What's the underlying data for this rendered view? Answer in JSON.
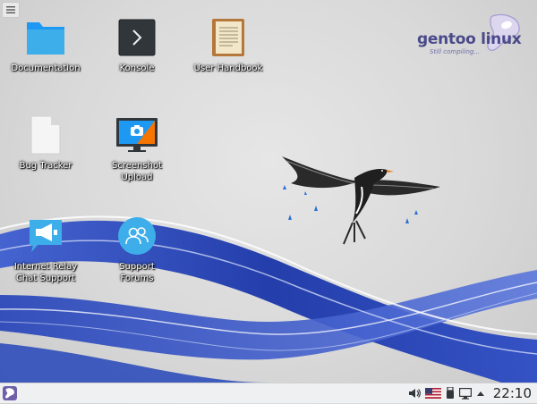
{
  "desktop": {
    "icons": [
      {
        "label": "Documentation",
        "icon": "folder-icon"
      },
      {
        "label": "Konsole",
        "icon": "terminal-icon"
      },
      {
        "label": "User Handbook",
        "icon": "handbook-icon"
      },
      {
        "label": "Bug Tracker",
        "icon": "document-icon"
      },
      {
        "label": "Screenshot\nUpload",
        "icon": "screenshot-icon"
      },
      {
        "label": "Internet Relay\nChat Support",
        "icon": "megaphone-icon"
      },
      {
        "label": "Support\nForums",
        "icon": "users-icon"
      }
    ]
  },
  "branding": {
    "name": "gentoo linux",
    "tagline": "Still compiling...",
    "mark": "™"
  },
  "taskbar": {
    "clock": "22:10",
    "tray_icons": [
      "volume-icon",
      "keyboard-layout-flag-icon",
      "usb-device-icon",
      "network-icon",
      "expand-tray-arrow-icon"
    ]
  },
  "colors": {
    "panel": "#eff0f1",
    "folder": "#3daee9",
    "wave_blue": "#1f3fb0",
    "brand_text": "#4a4a8a"
  }
}
